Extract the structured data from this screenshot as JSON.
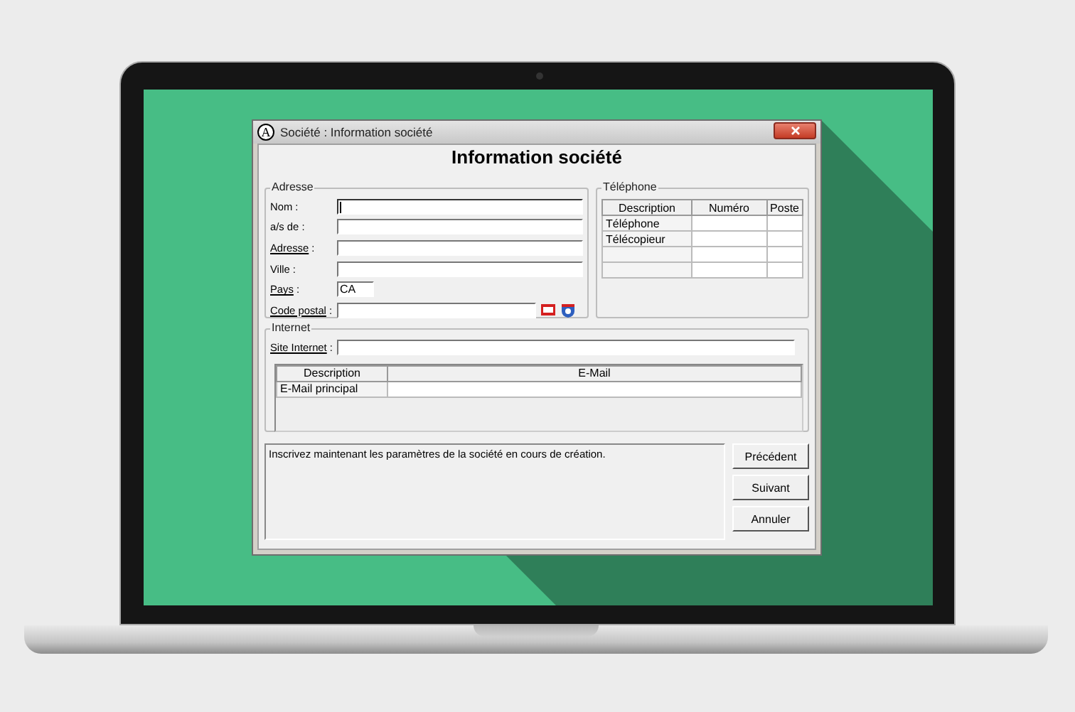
{
  "window": {
    "logo": "A",
    "title": "Société : Information société"
  },
  "heading": "Information société",
  "address": {
    "label": "Adresse",
    "fields": [
      {
        "label": "Nom",
        "suffix": " :",
        "underlined": false,
        "kind": "wide",
        "focused": true
      },
      {
        "label": "a/s de",
        "suffix": " :",
        "underlined": false,
        "kind": "wide",
        "focused": false
      },
      {
        "label": "Adresse",
        "suffix": " :",
        "underlined": true,
        "kind": "wide",
        "focused": false
      },
      {
        "label": "Ville",
        "suffix": " :",
        "underlined": false,
        "kind": "wide",
        "focused": false
      },
      {
        "label": "Pays",
        "suffix": " :",
        "underlined": true,
        "kind": "short",
        "focused": false,
        "value": "CA"
      },
      {
        "label": "Code postal",
        "suffix": " :",
        "underlined": true,
        "kind": "postal",
        "focused": false
      }
    ]
  },
  "telephone": {
    "label": "Téléphone",
    "columns": [
      "Description",
      "Numéro",
      "Poste"
    ],
    "rows": [
      [
        "Téléphone"
      ],
      [
        "Télécopieur"
      ]
    ]
  },
  "internet": {
    "label": "Internet",
    "site_label": "Site Internet",
    "site_suffix": " :",
    "columns": [
      "Description",
      "E-Mail"
    ],
    "rows": [
      [
        "E-Mail principal"
      ]
    ]
  },
  "message": "Inscrivez maintenant les paramètres de la société en cours de création.",
  "buttons": [
    "Précédent",
    "Suivant",
    "Annuler"
  ]
}
